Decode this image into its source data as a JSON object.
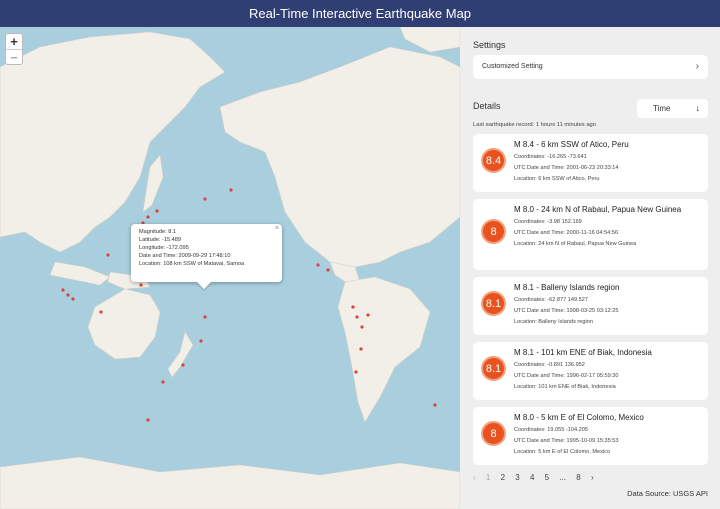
{
  "header": {
    "title": "Real-Time Interactive Earthquake Map"
  },
  "map": {
    "zoom_in": "+",
    "zoom_out": "−",
    "popup": {
      "close": "×",
      "lines": [
        "Magnitude: 8.1",
        "Latitude: -15.489",
        "Longitude: -172.095",
        "Date and Time: 2009-09-29 17:48:10",
        "Location: 108 km SSW of Matavai, Samoa"
      ]
    }
  },
  "panel": {
    "settings_title": "Settings",
    "settings_item": "Customized Setting",
    "settings_chevron": "›",
    "details_title": "Details",
    "sort_label": "Time",
    "sort_arrow": "↓",
    "last_record": "Last earthquake record: 1 hours 11 minutes ago",
    "cards": [
      {
        "mag": "8.4",
        "title": "M 8.4 - 6 km SSW of Atico, Peru",
        "coords": "Coordinates: -16.265 -73.641",
        "time": "UTC Date and Time: 2001-06-23 20:33:14",
        "location": "Location: 6 km SSW of Atico, Peru"
      },
      {
        "mag": "8",
        "title": "M 8.0 - 24 km N of Rabaul, Papua New Guinea",
        "coords": "Coordinates: -3.98 152.169",
        "time": "UTC Date and Time: 2000-11-16 04:54:56",
        "location": "Location: 24 km N of Rabaul, Papua New Guinea"
      },
      {
        "mag": "8.1",
        "title": "M 8.1 - Balleny Islands region",
        "coords": "Coordinates: -62.877 149.527",
        "time": "UTC Date and Time: 1998-03-25 03:12:25",
        "location": "Location: Balleny Islands region"
      },
      {
        "mag": "8.1",
        "title": "M 8.1 - 101 km ENE of Biak, Indonesia",
        "coords": "Coordinates: -0.891 136.952",
        "time": "UTC Date and Time: 1996-02-17 05:59:30",
        "location": "Location: 101 km ENE of Biak, Indonesia"
      },
      {
        "mag": "8",
        "title": "M 8.0 - 5 km E of El Colomo, Mexico",
        "coords": "Coordinates: 19.055 -104.205",
        "time": "UTC Date and Time: 1995-10-09 15:35:53",
        "location": "Location: 5 km E of El Colomo, Mexico"
      }
    ],
    "pagination": [
      "‹",
      "1",
      "2",
      "3",
      "4",
      "5",
      "...",
      "8",
      "›"
    ],
    "data_source": "Data Source: USGS API"
  },
  "colors": {
    "header": "#2f3f73",
    "ocean": "#a9cfdf",
    "land": "#f2efe9",
    "quake": "#d9453b",
    "badge": "#e8521f"
  }
}
